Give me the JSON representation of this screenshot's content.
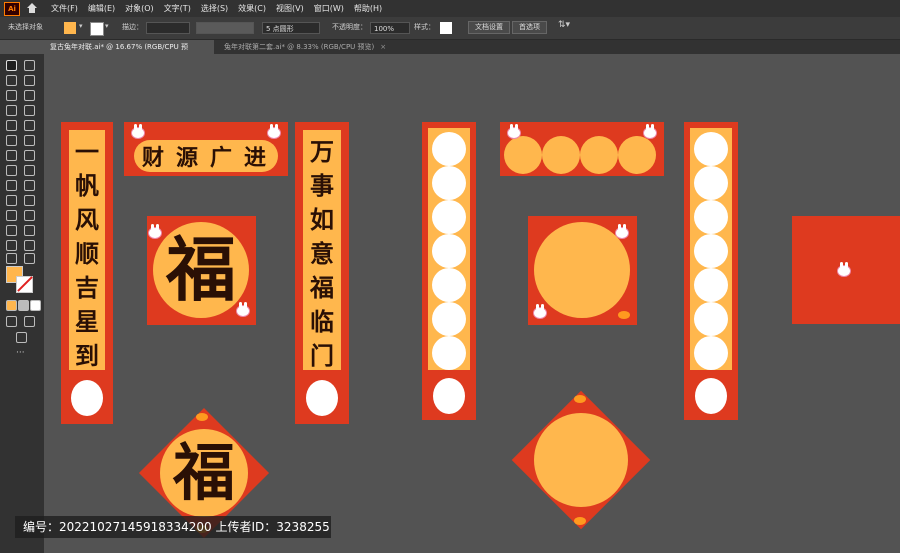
{
  "menubar": {
    "logo": "Ai",
    "items": [
      "文件(F)",
      "编辑(E)",
      "对象(O)",
      "文字(T)",
      "选择(S)",
      "效果(C)",
      "视图(V)",
      "窗口(W)",
      "帮助(H)"
    ]
  },
  "control_bar": {
    "selection_status": "未选择对象",
    "fill_color": "#ffb64d",
    "stroke_label": "描边：",
    "brush_value": "5 点圆形",
    "opacity_label": "不透明度：",
    "opacity_value": "100%",
    "style_label": "样式：",
    "doc_setup_button": "文档设置",
    "preferences_button": "首选项"
  },
  "tabs": [
    {
      "label": "复古兔年对联.ai* @ 16.67% (RGB/CPU 预览)",
      "active": true
    },
    {
      "label": "兔年对联第二套.ai* @ 8.33% (RGB/CPU 预览)",
      "active": false
    }
  ],
  "artwork": {
    "left_couplet": [
      "一",
      "帆",
      "风",
      "顺",
      "吉",
      "星",
      "到"
    ],
    "right_couplet": [
      "万",
      "事",
      "如",
      "意",
      "福",
      "临",
      "门"
    ],
    "horizontal_scroll": [
      "财",
      "源",
      "广",
      "进"
    ],
    "fu_square": "福",
    "fu_diamond": "福"
  },
  "footer_watermark": "编号：20221027145918334200 上传者ID：3238255",
  "colors": {
    "banner_red": "#de3a1f",
    "banner_gold": "#ffb74d",
    "circle_white": "#ffffff",
    "char_dark": "#2a1005"
  }
}
